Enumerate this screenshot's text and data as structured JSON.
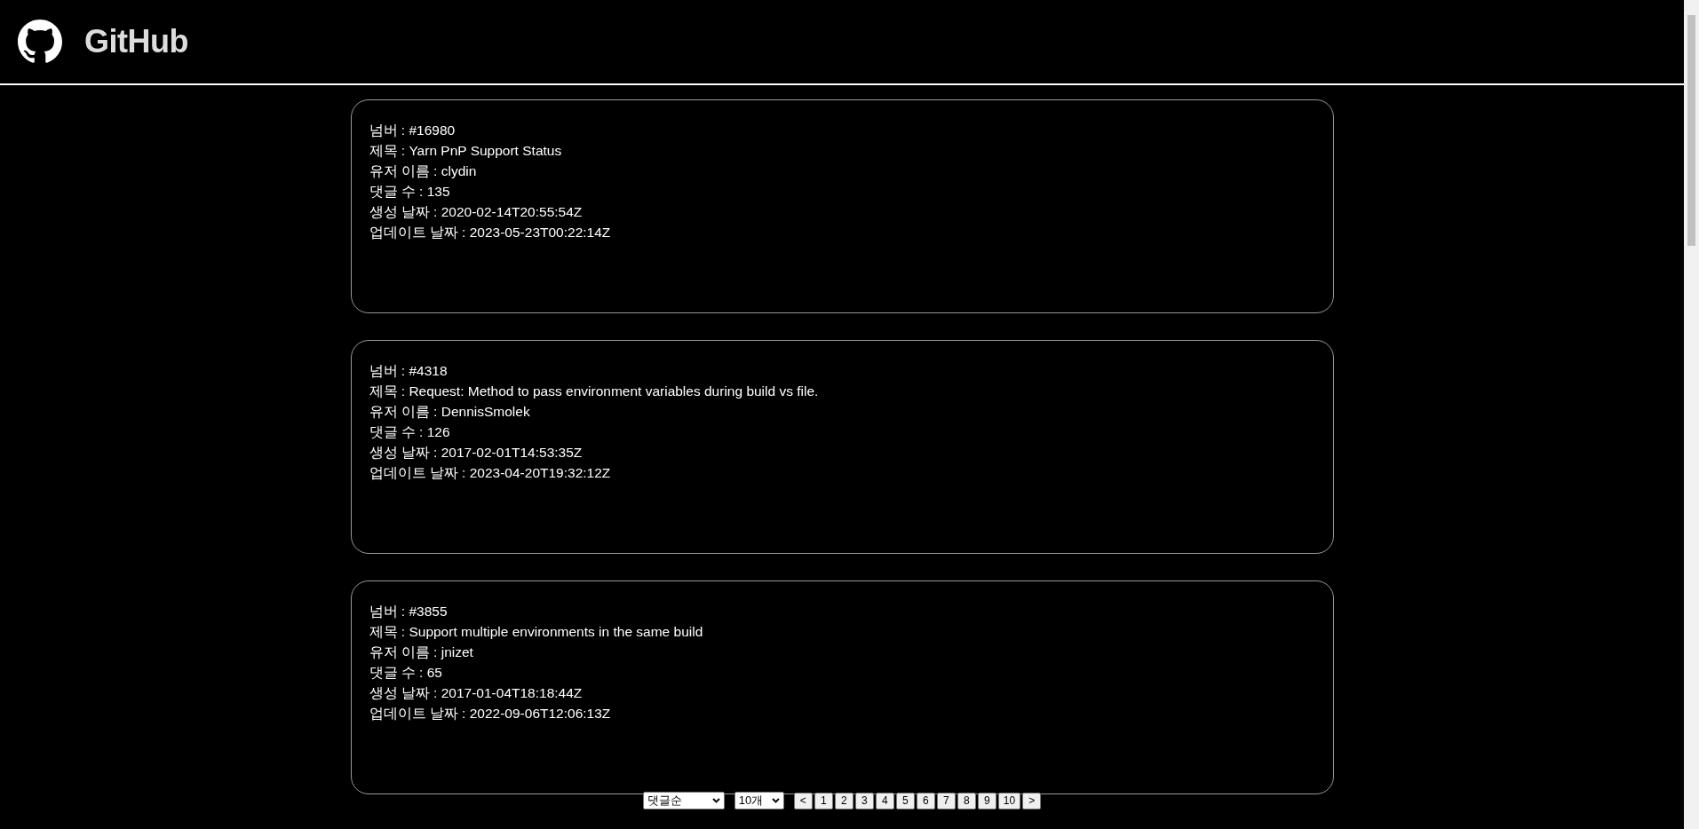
{
  "header": {
    "title": "GitHub"
  },
  "issues": [
    {
      "lines": [
        "넘버 : #16980",
        "제목 : Yarn PnP Support Status",
        "유저 이름 : clydin",
        "댓글 수 : 135",
        "생성 날짜 : 2020-02-14T20:55:54Z",
        "업데이트 날짜 : 2023-05-23T00:22:14Z"
      ]
    },
    {
      "lines": [
        "넘버 : #4318",
        "제목 : Request: Method to pass environment variables during build vs file.",
        "유저 이름 : DennisSmolek",
        "댓글 수 : 126",
        "생성 날짜 : 2017-02-01T14:53:35Z",
        "업데이트 날짜 : 2023-04-20T19:32:12Z"
      ]
    },
    {
      "lines": [
        "넘버 : #3855",
        "제목 : Support multiple environments in the same build",
        "유저 이름 : jnizet",
        "댓글 수 : 65",
        "생성 날짜 : 2017-01-04T18:18:44Z",
        "업데이트 날짜 : 2022-09-06T12:06:13Z"
      ]
    }
  ],
  "pagination": {
    "sort": "댓글순",
    "per_page": "10개",
    "prev": "<",
    "pages": [
      "1",
      "2",
      "3",
      "4",
      "5",
      "6",
      "7",
      "8",
      "9",
      "10"
    ],
    "next": ">"
  }
}
